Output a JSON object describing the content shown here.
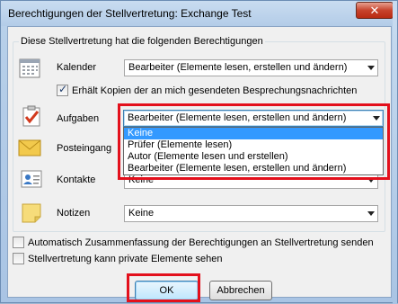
{
  "window": {
    "title": "Berechtigungen der Stellvertretung: Exchange Test",
    "close_glyph": "✕"
  },
  "group": {
    "heading": "Diese Stellvertretung hat die folgenden Berechtigungen"
  },
  "rows": [
    {
      "label": "Kalender",
      "icon": "calendar-icon",
      "value": "Bearbeiter (Elemente lesen, erstellen und ändern)"
    },
    {
      "label": "Aufgaben",
      "icon": "tasks-icon",
      "value": "Bearbeiter (Elemente lesen, erstellen und ändern)"
    },
    {
      "label": "Posteingang",
      "icon": "inbox-icon",
      "value": ""
    },
    {
      "label": "Kontakte",
      "icon": "contacts-icon",
      "value": "Keine"
    },
    {
      "label": "Notizen",
      "icon": "notes-icon",
      "value": "Keine"
    }
  ],
  "meeting_copy": {
    "label": "Erhält Kopien der an mich gesendeten Besprechungsnachrichten",
    "checked": true
  },
  "dropdown": {
    "options": [
      "Keine",
      "Prüfer (Elemente lesen)",
      "Autor (Elemente lesen und erstellen)",
      "Bearbeiter (Elemente lesen, erstellen und ändern)"
    ],
    "selected_index": 0
  },
  "options": {
    "auto_summary": "Automatisch Zusammenfassung der Berechtigungen an Stellvertretung senden",
    "private_items": "Stellvertretung kann private Elemente sehen"
  },
  "buttons": {
    "ok": "OK",
    "cancel": "Abbrechen"
  },
  "colors": {
    "highlight_box": "#e3101c",
    "selection": "#3399ff"
  }
}
